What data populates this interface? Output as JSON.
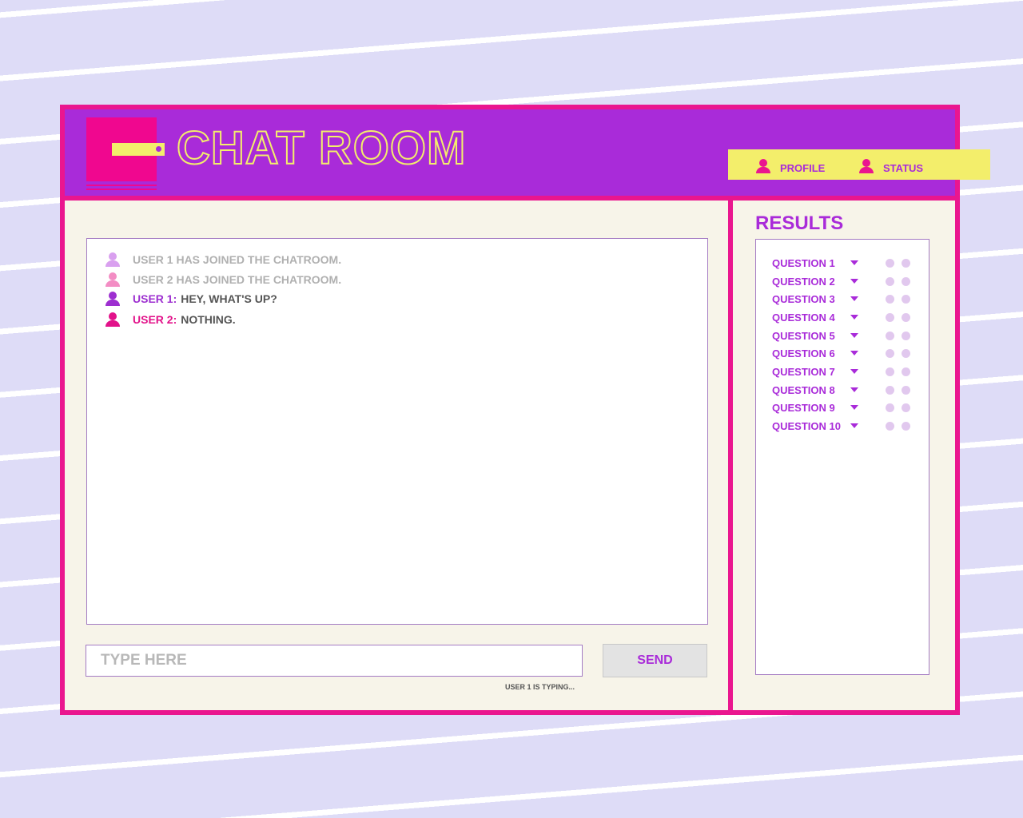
{
  "header": {
    "title": "CHAT ROOM",
    "profile_label": "PROFILE",
    "status_label": "STATUS"
  },
  "chat": {
    "messages": [
      {
        "type": "system",
        "text": "USER 1 HAS JOINED THE CHATROOM.",
        "icon": "user-icon",
        "color": "#d9a0ef"
      },
      {
        "type": "system",
        "text": "USER 2 HAS JOINED THE CHATROOM.",
        "icon": "user-icon",
        "color": "#f38dc4"
      },
      {
        "type": "message",
        "user": "USER 1:",
        "text": "HEY, WHAT'S UP?",
        "icon": "user-icon",
        "color": "#9d2fd0"
      },
      {
        "type": "message",
        "user": "USER 2:",
        "text": "NOTHING.",
        "icon": "user-icon",
        "color": "#e2128a"
      }
    ],
    "input_placeholder": "TYPE HERE",
    "send_label": "SEND",
    "typing_status": "USER 1 IS TYPING..."
  },
  "results": {
    "title": "RESULTS",
    "questions": [
      "QUESTION 1",
      "QUESTION 2",
      "QUESTION 3",
      "QUESTION 4",
      "QUESTION 5",
      "QUESTION 6",
      "QUESTION 7",
      "QUESTION 8",
      "QUESTION 9",
      "QUESTION 10"
    ]
  },
  "colors": {
    "accent_pink": "#ea168f",
    "accent_purple": "#a92bd9",
    "accent_yellow": "#f3ee6b",
    "panel_bg": "#f7f4e9",
    "page_bg": "#dedcf7"
  }
}
